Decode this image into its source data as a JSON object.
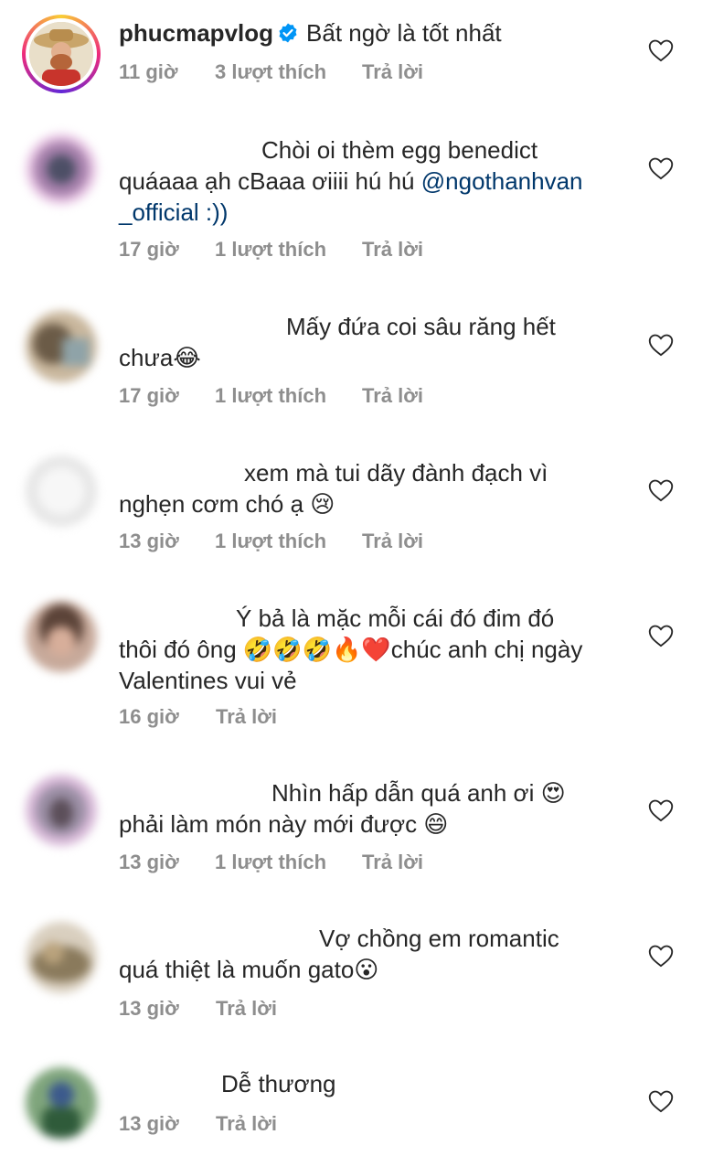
{
  "comments": [
    {
      "username": "phucmapvlog",
      "verified": true,
      "lines": [
        "Bất ngờ là tốt nhất"
      ],
      "time": "11 giờ",
      "likes": "3 lượt thích",
      "reply": "Trả lời"
    },
    {
      "lines": [
        "Chòi oi thèm egg benedict",
        "quáaaa ạh cBaaa ơiiii hú hú ",
        "_official :))"
      ],
      "mention_part1": "@ngothanhvan",
      "time": "17 giờ",
      "likes": "1 lượt thích",
      "reply": "Trả lời"
    },
    {
      "lines": [
        "Mấy đứa coi sâu răng hết",
        "chưa😂"
      ],
      "time": "17 giờ",
      "likes": "1 lượt thích",
      "reply": "Trả lời"
    },
    {
      "lines": [
        "xem mà tui dãy đành đạch vì",
        "nghẹn cơm chó ạ 😢"
      ],
      "time": "13 giờ",
      "likes": "1 lượt thích",
      "reply": "Trả lời"
    },
    {
      "lines": [
        "Ý bả là mặc mỗi cái đó đim đó",
        "thôi đó ông 🤣🤣🤣🔥❤️chúc anh chị ngày",
        "Valentines vui vẻ"
      ],
      "time": "16 giờ",
      "reply": "Trả lời"
    },
    {
      "lines": [
        "Nhìn hấp dẫn quá anh ơi 😍",
        "phải làm món này mới được 😄"
      ],
      "time": "13 giờ",
      "likes": "1 lượt thích",
      "reply": "Trả lời"
    },
    {
      "lines": [
        "Vợ chồng em romantic",
        "quá thiệt là muốn gato😮"
      ],
      "time": "13 giờ",
      "reply": "Trả lời"
    },
    {
      "lines": [
        "Dễ thương"
      ],
      "time": "13 giờ",
      "reply": "Trả lời"
    }
  ],
  "colors": {
    "text": "#262626",
    "meta": "#8e8e8e",
    "mention": "#00376b",
    "verified": "#0095f6"
  },
  "icons": [
    "heart-icon",
    "verified-badge-icon"
  ]
}
